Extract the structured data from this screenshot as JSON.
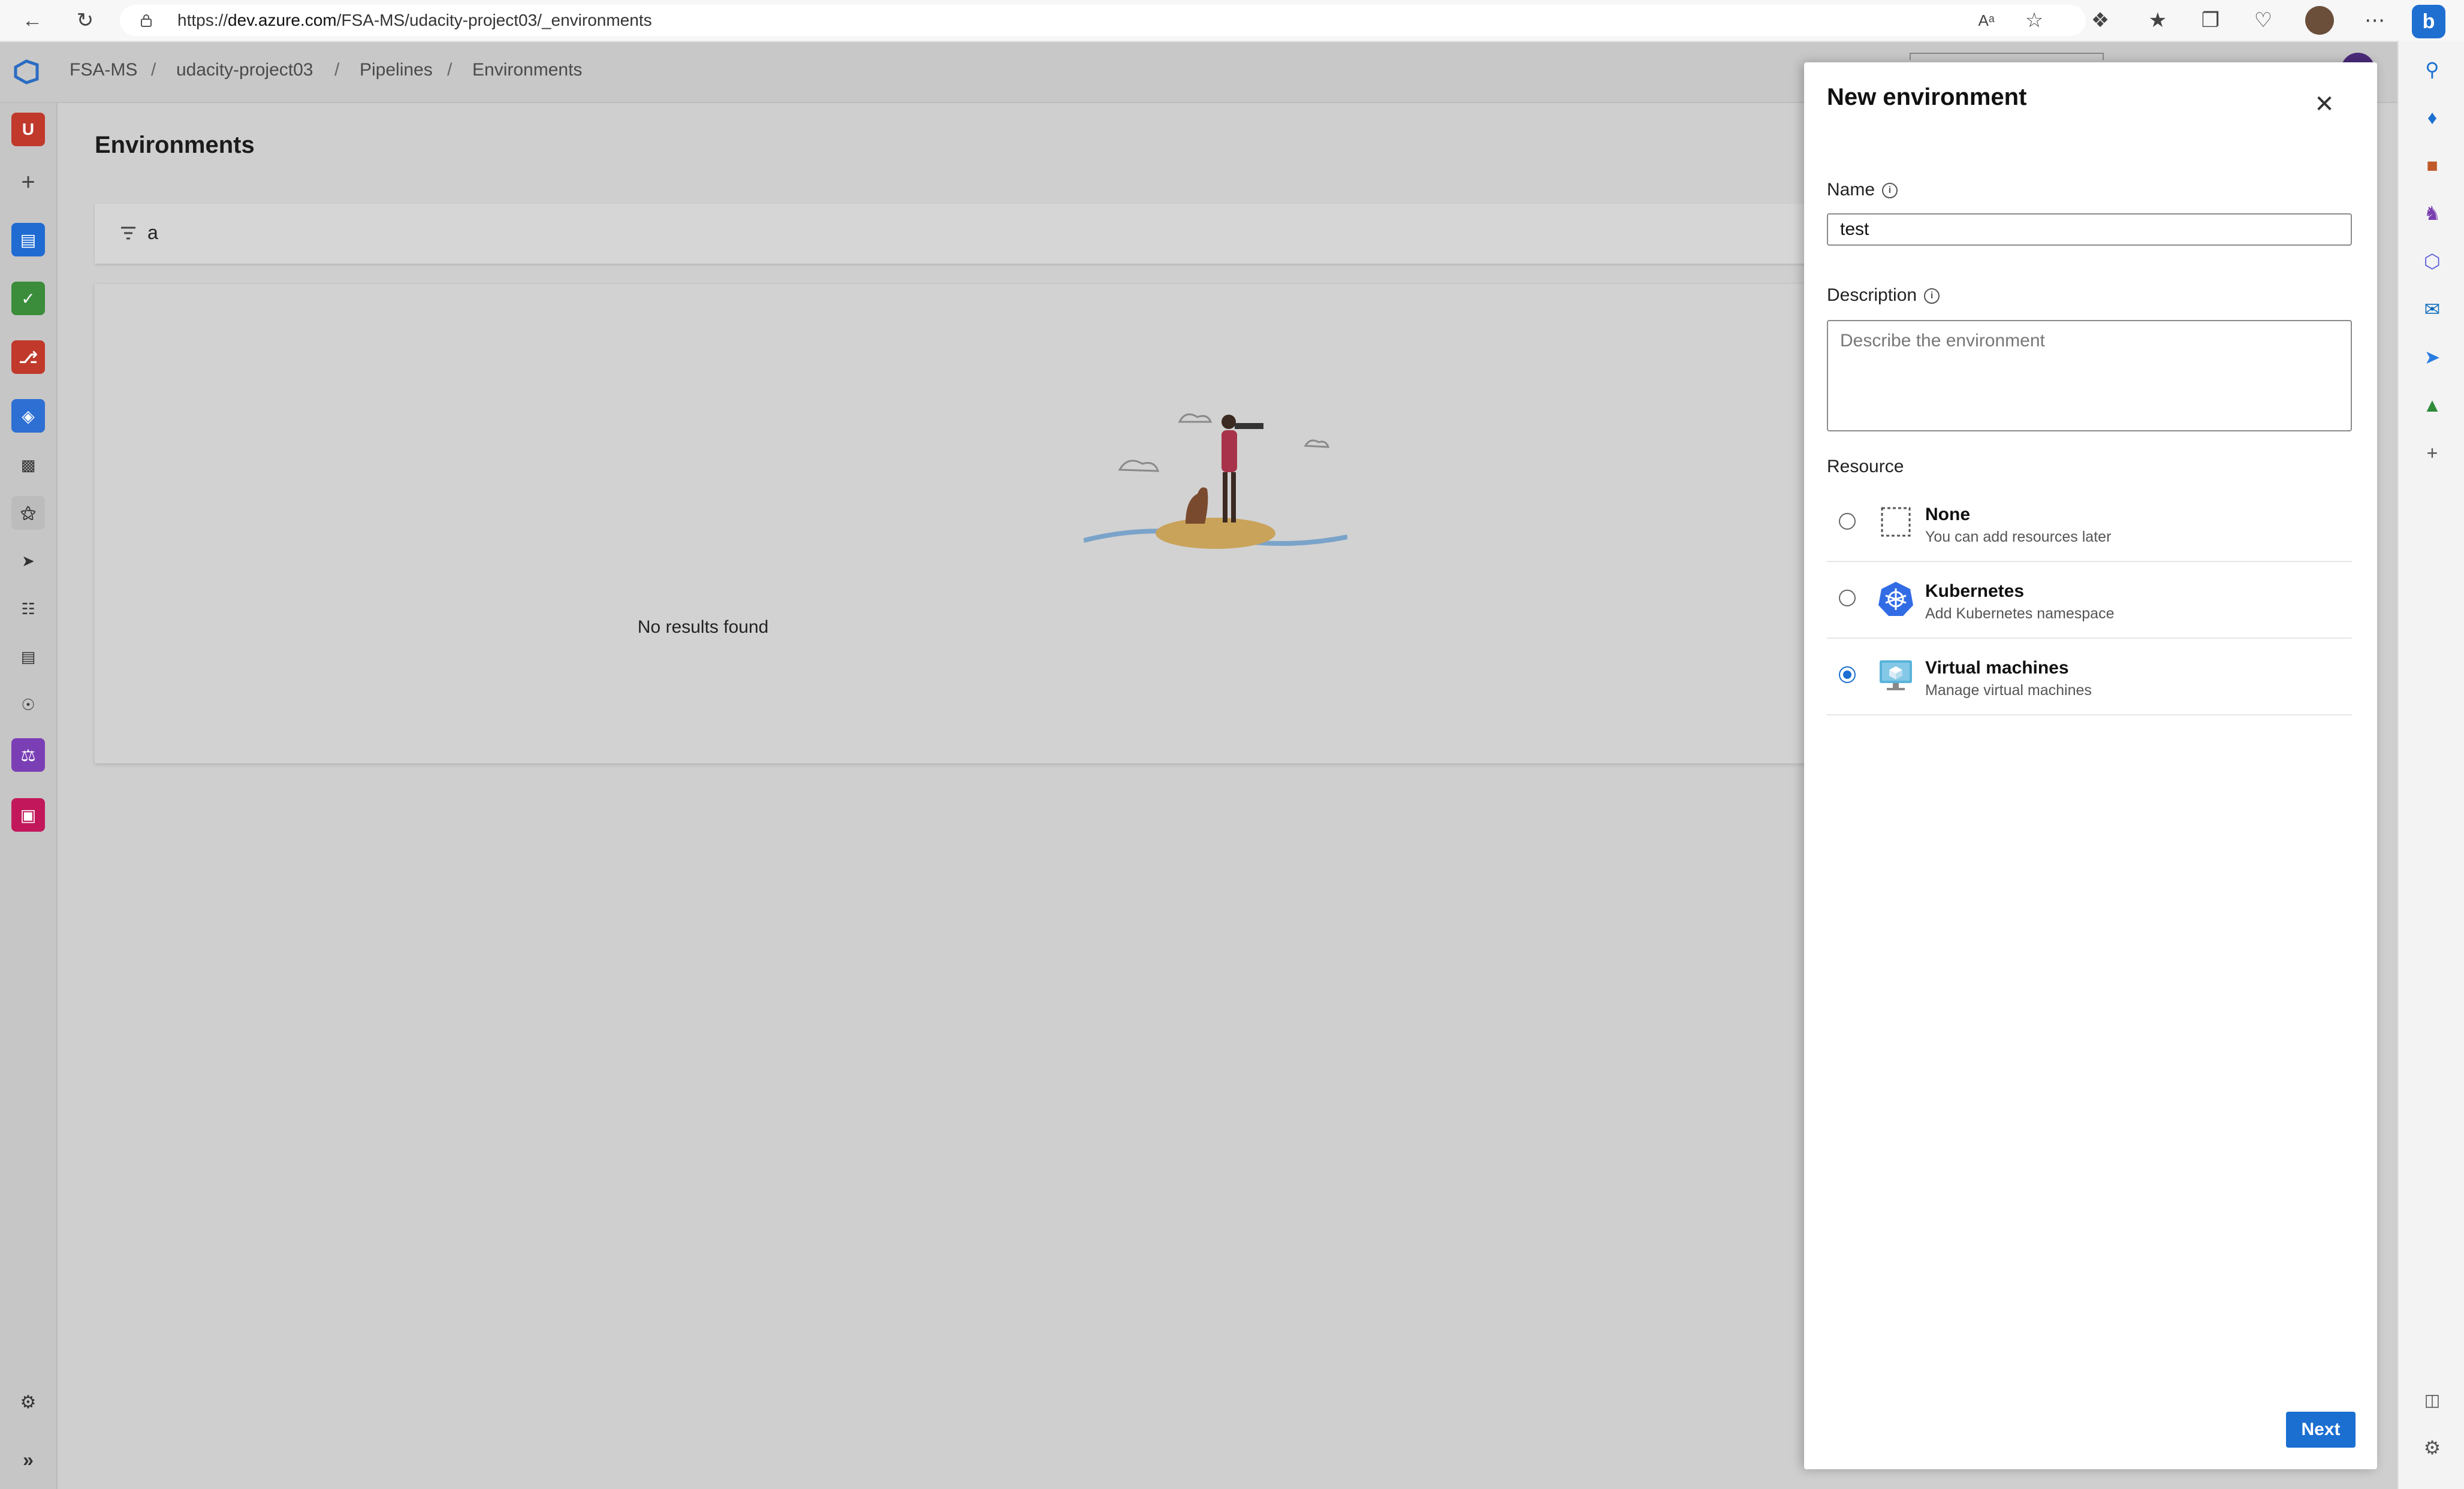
{
  "browser": {
    "url_prefix": "https://",
    "url_host": "dev.azure.com",
    "url_path": "/FSA-MS/udacity-project03/_environments",
    "read_aloud_label": "Aᵃ"
  },
  "breadcrumb": {
    "org": "FSA-MS",
    "project": "udacity-project03",
    "section": "Pipelines",
    "page": "Environments",
    "separator": "/"
  },
  "left_rail": {
    "project_avatar_letter": "U"
  },
  "main": {
    "title": "Environments",
    "filter_value": "a",
    "empty_state_text": "No results found"
  },
  "panel": {
    "title": "New environment",
    "name_label": "Name",
    "name_value": "test",
    "description_label": "Description",
    "description_placeholder": "Describe the environment",
    "resource_label": "Resource",
    "resources": [
      {
        "title": "None",
        "subtitle": "You can add resources later",
        "selected": false
      },
      {
        "title": "Kubernetes",
        "subtitle": "Add Kubernetes namespace",
        "selected": false
      },
      {
        "title": "Virtual machines",
        "subtitle": "Manage virtual machines",
        "selected": true
      }
    ],
    "next_label": "Next"
  },
  "colors": {
    "accent": "#1a6fd1",
    "overlay_background": "#cfcfcf",
    "panel_background": "#ffffff"
  }
}
